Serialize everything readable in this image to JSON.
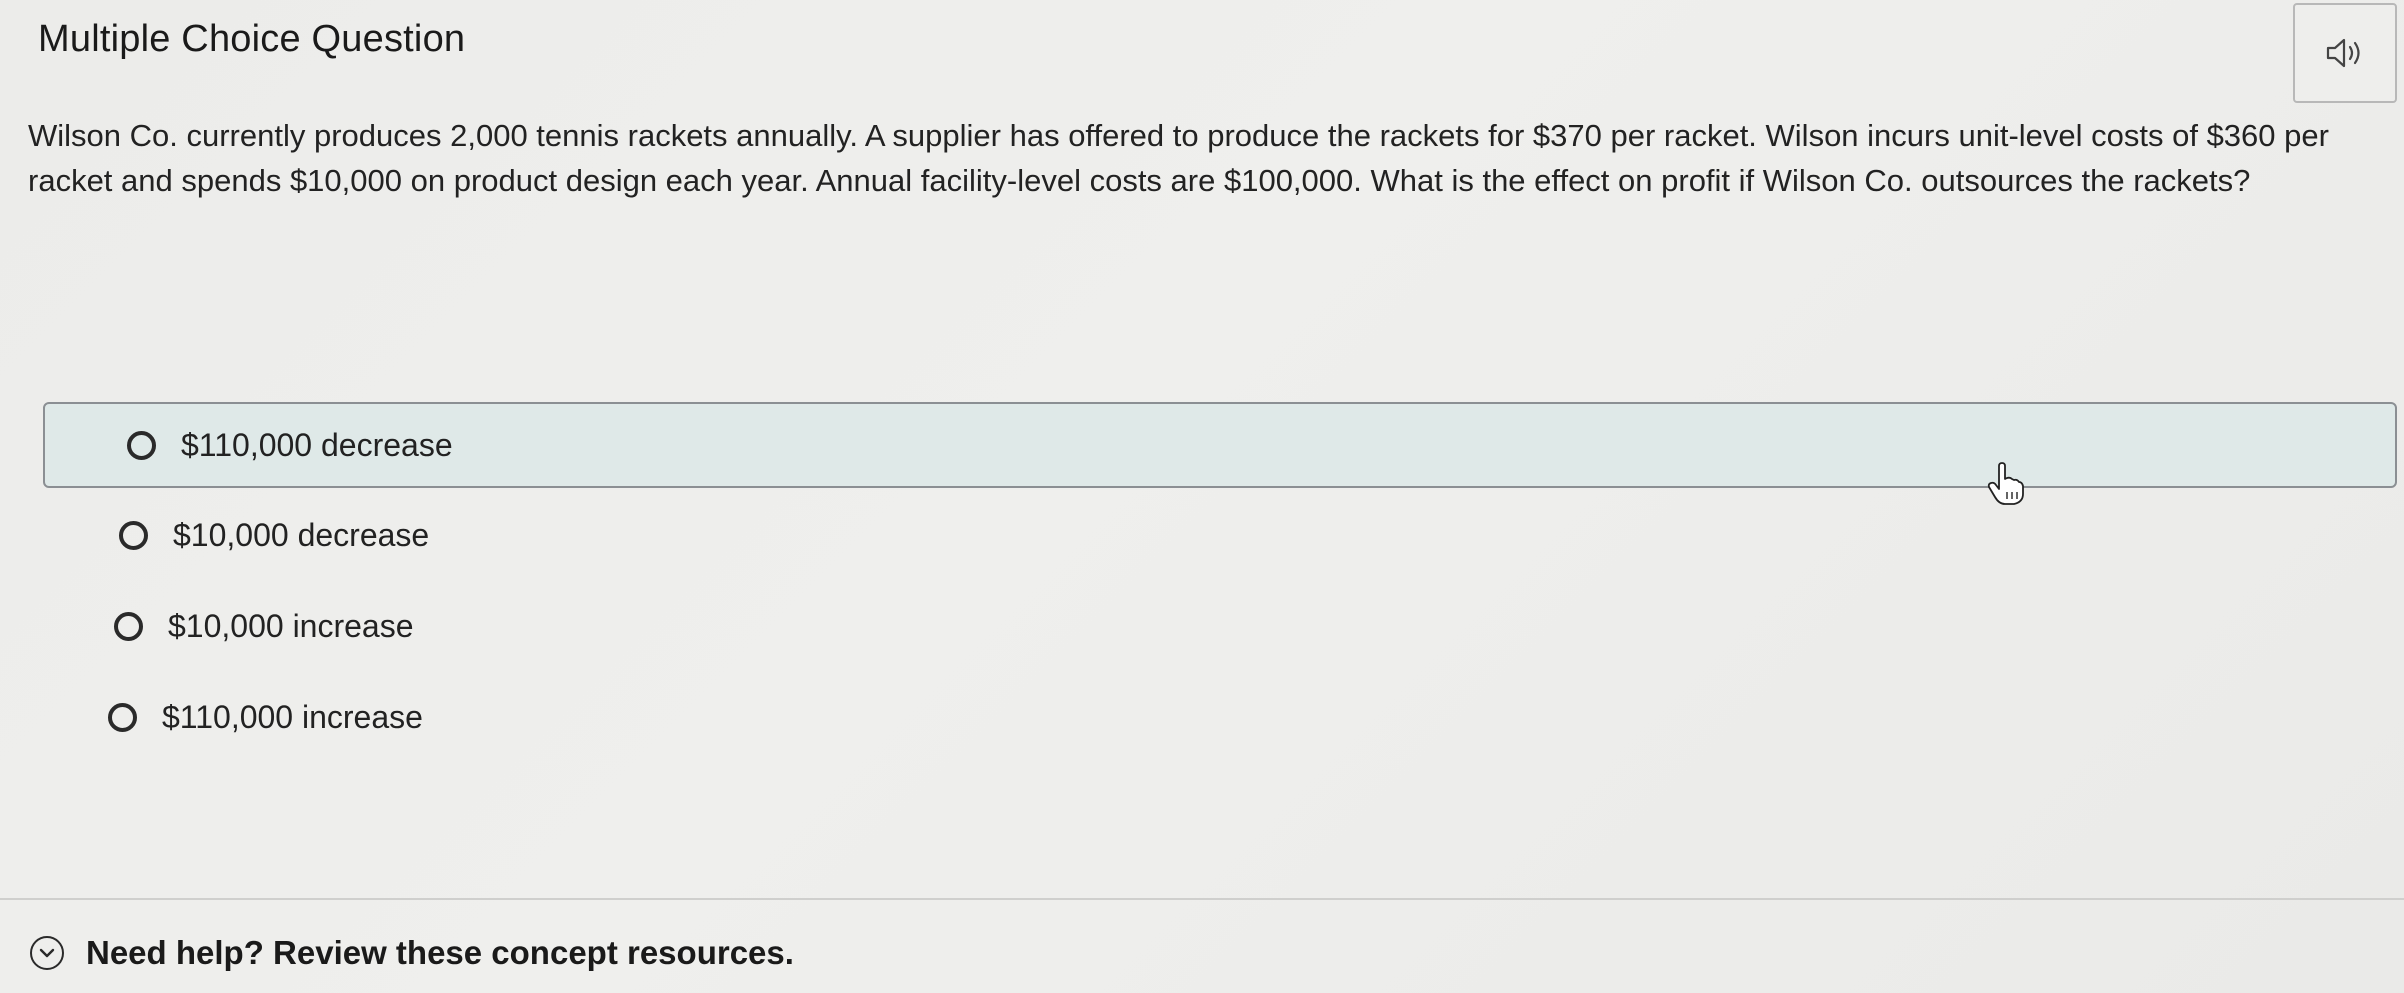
{
  "header": {
    "title": "Multiple Choice Question",
    "audio_icon": "speaker-icon"
  },
  "question": {
    "text": "Wilson Co. currently produces 2,000 tennis rackets annually. A supplier has offered to produce the rackets for $370 per racket. Wilson incurs unit-level costs of $360 per racket and spends $10,000 on product design each year.  Annual facility-level costs are $100,000. What is the effect on profit if Wilson Co. outsources the rackets?"
  },
  "choices": [
    {
      "label": "$110,000 decrease",
      "state": "hovered"
    },
    {
      "label": "$10,000 decrease"
    },
    {
      "label": "$10,000 increase"
    },
    {
      "label": "$110,000 increase"
    }
  ],
  "help": {
    "text": "Need help? Review these concept resources.",
    "icon": "chevron-down-circle-icon"
  },
  "colors": {
    "hover_background": "#dfe9e8",
    "hover_border": "#8b8f93",
    "page_background": "#ececea"
  }
}
